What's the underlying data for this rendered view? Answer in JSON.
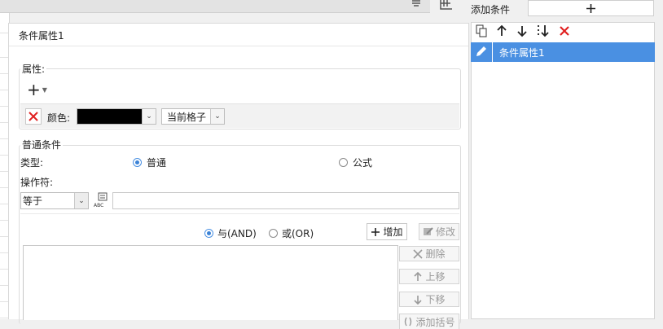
{
  "top_right": {
    "add_condition_label": "添加条件",
    "add_icon": "plus-icon"
  },
  "toolbar_icons": [
    "copy-icon",
    "move-up-icon",
    "move-down-icon",
    "move-bottom-icon",
    "delete-icon"
  ],
  "condition_list": {
    "items": [
      {
        "label": "条件属性1",
        "icon": "pencil-icon",
        "selected": true
      }
    ]
  },
  "dialog": {
    "title": "条件属性1",
    "attributes": {
      "label": "属性:",
      "add_symbol": "+",
      "color_label": "颜色:",
      "color_value": "#000000",
      "scope_value": "当前格子"
    },
    "normal_condition": {
      "label": "普通条件",
      "type_label": "类型:",
      "option_normal": "普通",
      "option_formula": "公式",
      "selected": "普通",
      "operator_label": "操作符:",
      "operator_value": "等于",
      "value_input": "",
      "logic_and": "与(AND)",
      "logic_or": "或(OR)",
      "logic_selected": "与(AND)",
      "add_button": "增加",
      "modify_button": "修改",
      "delete_button": "删除",
      "up_button": "上移",
      "down_button": "下移",
      "add_bracket_button": "添加括号"
    }
  }
}
